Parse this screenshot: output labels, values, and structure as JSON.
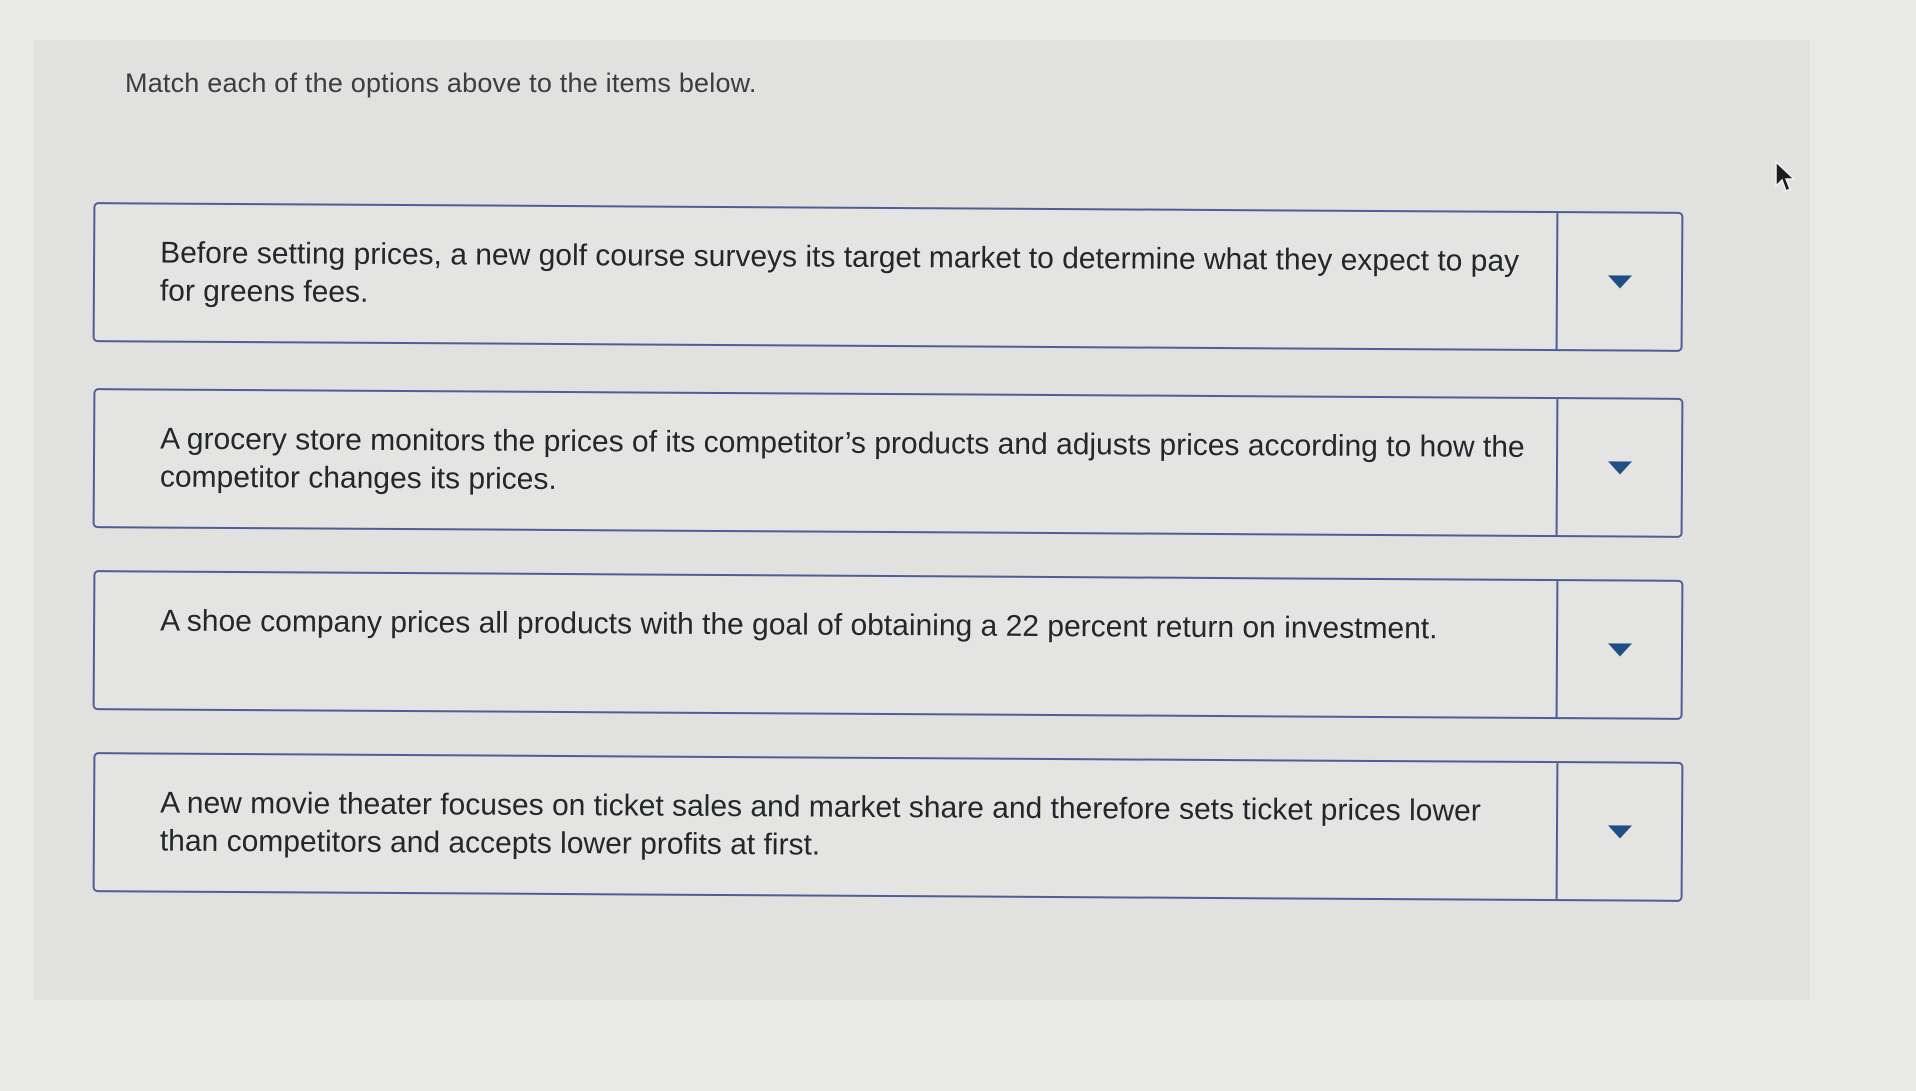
{
  "instruction": "Match each of the options above to the items below.",
  "items": [
    {
      "text": "Before setting prices, a new golf course surveys its target market to determine what they expect to pay for greens fees.",
      "selected": ""
    },
    {
      "text": "A grocery store monitors the prices of its competitor’s products and adjusts prices according to how the competitor changes its prices.",
      "selected": ""
    },
    {
      "text": "A shoe company prices all products with the goal of obtaining a 22 percent return on investment.",
      "selected": ""
    },
    {
      "text": "A new movie theater focuses on ticket sales and market share and therefore sets ticket prices lower than competitors and accepts lower profits at first.",
      "selected": ""
    }
  ],
  "icons": {
    "dropdown": "chevron-down-icon",
    "cursor": "mouse-pointer-icon"
  },
  "colors": {
    "border": "#4e5e96",
    "caret": "#1f4f86",
    "background": "#e1e1df"
  }
}
